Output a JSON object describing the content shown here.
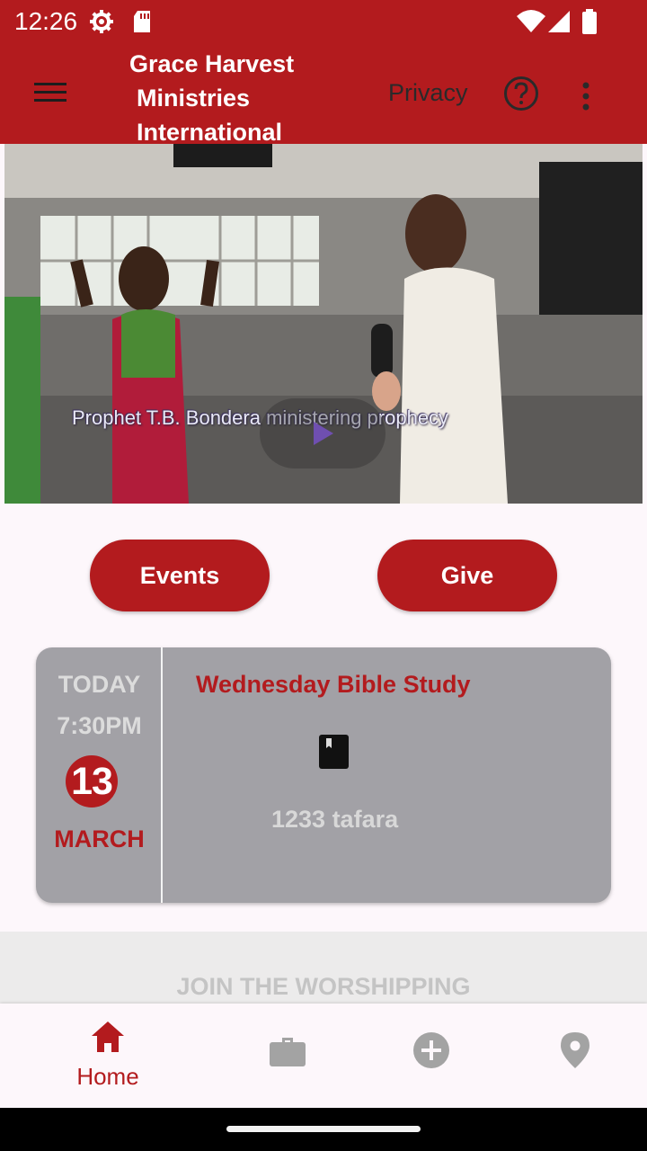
{
  "status_bar": {
    "time": "12:26",
    "icons": [
      "settings-gear-icon",
      "sd-card-icon",
      "wifi-icon",
      "cell-signal-icon",
      "battery-icon"
    ]
  },
  "app_bar": {
    "title_lines": [
      "Grace Harvest",
      "Ministries",
      "International"
    ],
    "privacy_label": "Privacy",
    "icons": [
      "menu-icon",
      "help-circle-icon",
      "more-vert-icon"
    ],
    "background_color": "#b31b1e"
  },
  "video": {
    "caption": "Prophet T.B. Bondera ministering prophecy",
    "icon": "play-icon"
  },
  "actions": {
    "events_label": "Events",
    "give_label": "Give"
  },
  "event": {
    "day_label": "TODAY",
    "time": "7:30PM",
    "day_number": "13",
    "month": "MARCH",
    "title": "Wednesday Bible Study",
    "icon": "book-icon",
    "location": "1233 tafara"
  },
  "worship": {
    "heading": "JOIN THE WORSHIPPING"
  },
  "bottom_nav": {
    "items": [
      {
        "label": "Home",
        "icon": "home-icon",
        "active": true
      },
      {
        "label": "",
        "icon": "briefcase-icon",
        "active": false
      },
      {
        "label": "",
        "icon": "add-circle-icon",
        "active": false
      },
      {
        "label": "",
        "icon": "location-pin-icon",
        "active": false
      }
    ],
    "active_color": "#b31b1e",
    "inactive_color": "#a3a3a3"
  }
}
